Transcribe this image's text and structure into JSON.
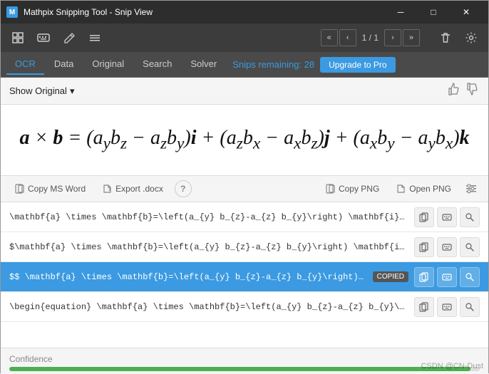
{
  "titlebar": {
    "icon_label": "M",
    "title": "Mathpix Snipping Tool - Snip View",
    "minimize_label": "─",
    "maximize_label": "□",
    "close_label": "✕"
  },
  "toolbar": {
    "snip_icon": "⊞",
    "keyboard_icon": "⌨",
    "edit_icon": "✎",
    "menu_icon": "≡",
    "nav_prev_prev": "«",
    "nav_prev": "‹",
    "nav_label": "1 / 1",
    "nav_next": "›",
    "nav_next_next": "»",
    "trash_icon": "🗑",
    "settings_icon": "⚙"
  },
  "tabs": {
    "items": [
      {
        "label": "OCR",
        "id": "ocr",
        "active": true
      },
      {
        "label": "Data",
        "id": "data",
        "active": false
      },
      {
        "label": "Original",
        "id": "original",
        "active": false
      },
      {
        "label": "Search",
        "id": "search",
        "active": false
      },
      {
        "label": "Solver",
        "id": "solver",
        "active": false
      }
    ],
    "snips_remaining": "Snips remaining: 28",
    "upgrade_label": "Upgrade to Pro"
  },
  "show_original": {
    "label": "Show Original",
    "chevron": "▾",
    "thumbup_icon": "👍",
    "thumbdown_icon": "👎"
  },
  "math_display": {
    "formula": "a × b = (aₙbₓ − aₓbₙ)i + (aₓbₗ − aₗbₓ)j + (aₗbₙ − aₙbₗ)k"
  },
  "action_bar": {
    "copy_msword_icon": "📄",
    "copy_msword_label": "Copy MS Word",
    "export_docx_icon": "↗",
    "export_docx_label": "Export .docx",
    "help_icon": "?",
    "copy_png_icon": "📋",
    "copy_png_label": "Copy PNG",
    "open_png_icon": "↗",
    "open_png_label": "Open PNG",
    "settings_icon": "⚙"
  },
  "latex_rows": [
    {
      "id": "row1",
      "text": "\\mathbf{a} \\times \\mathbf{b}=\\left(a_{y} b_{z}-a_{z} b_{y}\\right) \\mathbf{i}+\\left(a_",
      "active": false,
      "show_copied": false,
      "icons": [
        "copy",
        "keyboard",
        "search"
      ]
    },
    {
      "id": "row2",
      "text": "$\\mathbf{a} \\times \\mathbf{b}=\\left(a_{y} b_{z}-a_{z} b_{y}\\right) \\mathbf{i}+\\left(a",
      "active": false,
      "show_copied": false,
      "icons": [
        "copy",
        "keyboard",
        "search"
      ]
    },
    {
      "id": "row3",
      "text": "$$  \\mathbf{a} \\times \\mathbf{b}=\\left(a_{y} b_{z}-a_{z} b_{y}\\right) \\mathbf",
      "active": true,
      "show_copied": true,
      "copied_label": "COPIED",
      "icons": [
        "copy",
        "keyboard",
        "search"
      ]
    },
    {
      "id": "row4",
      "text": "\\begin{equation}  \\mathbf{a} \\times \\mathbf{b}=\\left(a_{y} b_{z}-a_{z} b_{y}\\right) \\",
      "active": false,
      "show_copied": false,
      "icons": [
        "copy",
        "keyboard",
        "search"
      ]
    }
  ],
  "confidence": {
    "label": "Confidence",
    "percent": 98
  },
  "watermark": {
    "text": "CSDN @CN-Dust"
  },
  "icons": {
    "copy": "📋",
    "keyboard": "⌨",
    "search": "🔍"
  }
}
